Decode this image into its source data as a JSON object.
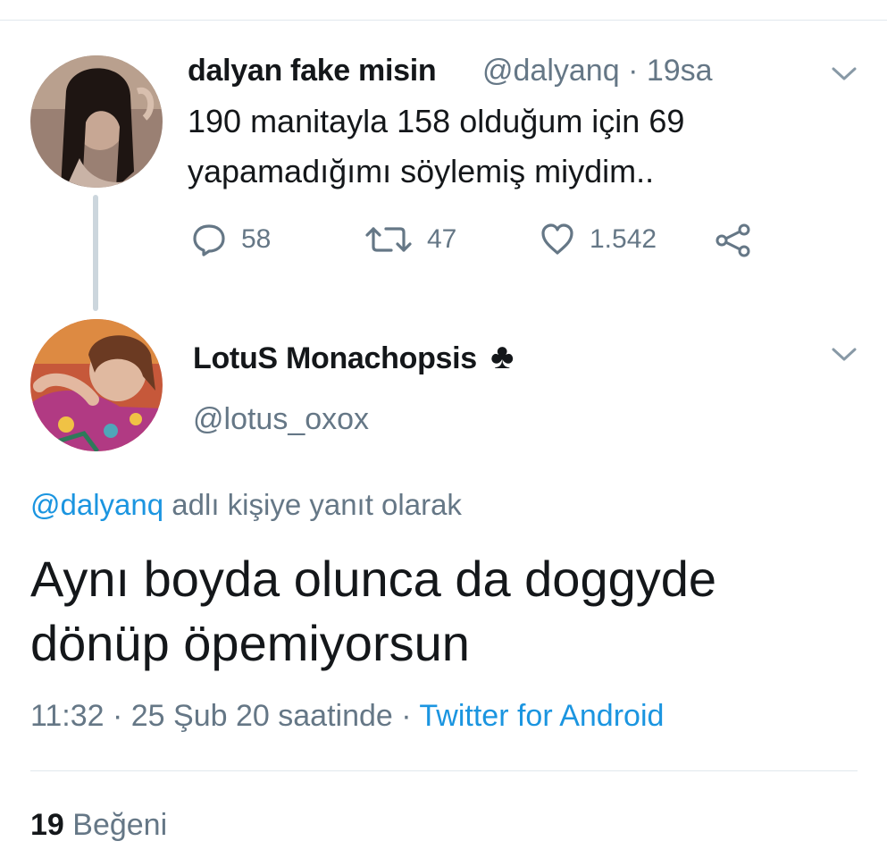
{
  "original_tweet": {
    "display_name": "dalyan fake misin",
    "handle": "@dalyanq",
    "time": "· 19sa",
    "text_line1": "190 manitayla 158 olduğum için 69",
    "text_line2": "yapamadığımı söylemiş miydim..",
    "actions": {
      "reply_count": "58",
      "retweet_count": "47",
      "like_count": "1.542"
    },
    "avatar_icon": "profile-photo-woman-dark-hair"
  },
  "reply_tweet": {
    "display_name": "LotuS Monachopsis",
    "badge_glyph": "♣",
    "handle": "@lotus_oxox",
    "avatar_icon": "profile-photo-woman-pink-outfit",
    "reply_to_mention": "@dalyanq",
    "reply_to_suffix": " adlı kişiye yanıt olarak",
    "text_line1": "Aynı boyda olunca da doggyde",
    "text_line2": "dönüp öpemiyorsun",
    "timestamp": "11:32 · 25 Şub 20 saatinde · ",
    "source": "Twitter for Android",
    "like_count": "19",
    "like_label": " Beğeni"
  },
  "colors": {
    "accent": "#1b95e0",
    "secondary_text": "#657786",
    "primary_text": "#14171a",
    "divider": "#e1e8ed",
    "thread_line": "#ccd6dd"
  }
}
